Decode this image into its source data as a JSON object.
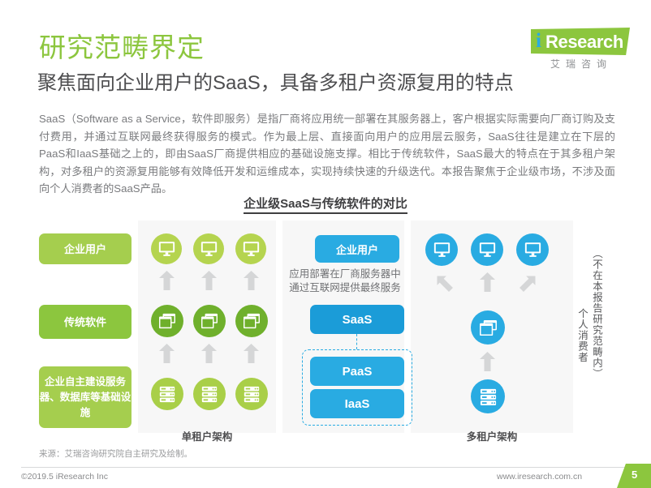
{
  "header": {
    "title": "研究范畴界定",
    "subtitle": "聚焦面向企业用户的SaaS，具备多租户资源复用的特点",
    "body": "SaaS（Software as a Service，软件即服务）是指厂商将应用统一部署在其服务器上，客户根据实际需要向厂商订购及支付费用，并通过互联网最终获得服务的模式。作为最上层、直接面向用户的应用层云服务，SaaS往往是建立在下层的PaaS和IaaS基础之上的，即由SaaS厂商提供相应的基础设施支撑。相比于传统软件，SaaS最大的特点在于其多租户架构，对多租户的资源复用能够有效降低开发和运维成本，实现持续快速的升级迭代。本报告聚焦于企业级市场，不涉及面向个人消费者的SaaS产品。"
  },
  "logo": {
    "initial": "i",
    "word": "Research",
    "chinese": "艾瑞咨询"
  },
  "diagram": {
    "title": "企业级SaaS与传统软件的对比",
    "left": {
      "labels": [
        "企业用户",
        "传统软件",
        "企业自主建设服务器、数据库等基础设施"
      ],
      "caption": "单租户架构",
      "icon_rows": [
        "monitor-icon",
        "application-window-icon",
        "server-rack-icon"
      ],
      "columns": 3
    },
    "middle": {
      "user_label": "企业用户",
      "note": "应用部署在厂商服务器中通过互联网提供最终服务",
      "layers": [
        "SaaS",
        "PaaS",
        "IaaS"
      ]
    },
    "right": {
      "caption": "多租户架构",
      "icon_rows": [
        "monitor-icon",
        "application-window-icon",
        "server-rack-icon"
      ],
      "monitor_count": 3
    },
    "vertical_notes": {
      "scope": "（不在本报告研究范畴内）",
      "consumer": "个人消费者"
    }
  },
  "footer": {
    "source": "来源：艾瑞咨询研究院自主研究及绘制。",
    "copyright": "©2019.5 iResearch Inc",
    "website": "www.iresearch.com.cn",
    "page_number": "5"
  },
  "colors": {
    "green": "#8cc63e",
    "green_light": "#a5ce4e",
    "green_mid": "#6fb02c",
    "blue": "#29abe2",
    "blue_dark": "#1b9cd8",
    "arrow_gray": "#d5d6d7",
    "panel_bg": "#f7f7f7"
  }
}
